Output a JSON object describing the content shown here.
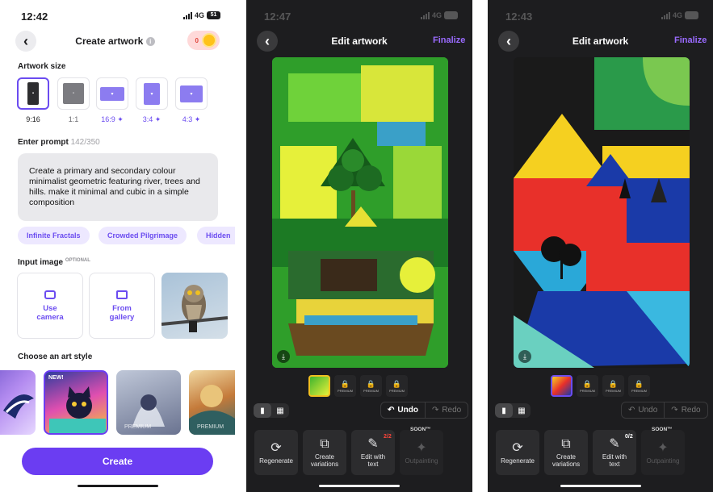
{
  "screen1": {
    "time": "12:42",
    "network": "4G",
    "battery": "51",
    "title": "Create artwork",
    "credits": "0",
    "artwork_size_label": "Artwork size",
    "sizes": [
      "9:16",
      "1:1",
      "16:9 ✦",
      "3:4 ✦",
      "4:3 ✦"
    ],
    "prompt_label": "Enter prompt",
    "prompt_count": "142/350",
    "prompt_text": "Create a primary and secondary colour minimalist geometric featuring river, trees and hills. make it minimal and cubic in a simple composition",
    "chips": [
      "Infinite Fractals",
      "Crowded Pilgrimage",
      "Hidden"
    ],
    "input_image_label": "Input image",
    "optional": "OPTIONAL",
    "use_camera": "Use camera",
    "from_gallery": "From gallery",
    "art_style_label": "Choose an art style",
    "new_badge": "NEW!",
    "premium_label": "PREMIUM",
    "create_button": "Create"
  },
  "screen2": {
    "time": "12:47",
    "network": "4G",
    "title": "Edit artwork",
    "finalize": "Finalize",
    "premium": "PREMIUM",
    "undo": "Undo",
    "redo": "Redo",
    "tools": [
      "Regenerate",
      "Create variations",
      "Edit with text",
      "Outpainting"
    ],
    "edit_count": "2/2",
    "soon": "SOON™"
  },
  "screen3": {
    "time": "12:43",
    "network": "4G",
    "title": "Edit artwork",
    "finalize": "Finalize",
    "premium": "PREMIUM",
    "undo": "Undo",
    "redo": "Redo",
    "tools": [
      "Regenerate",
      "Create variations",
      "Edit with text",
      "Outpainting"
    ],
    "edit_count": "0/2",
    "soon": "SOON™"
  },
  "colors": {
    "accent": "#6b3df2",
    "finalize": "#9a6bff",
    "chip_bg": "#ede8ff",
    "dark_bg": "#1d1d1f"
  },
  "icons": [
    "back-arrow-icon",
    "info-icon",
    "coin-icon",
    "camera-icon",
    "gallery-icon",
    "lock-icon",
    "undo-icon",
    "redo-icon",
    "regenerate-icon",
    "variations-icon",
    "edit-text-icon",
    "outpainting-icon",
    "single-view-icon",
    "grid-view-icon",
    "save-icon"
  ]
}
